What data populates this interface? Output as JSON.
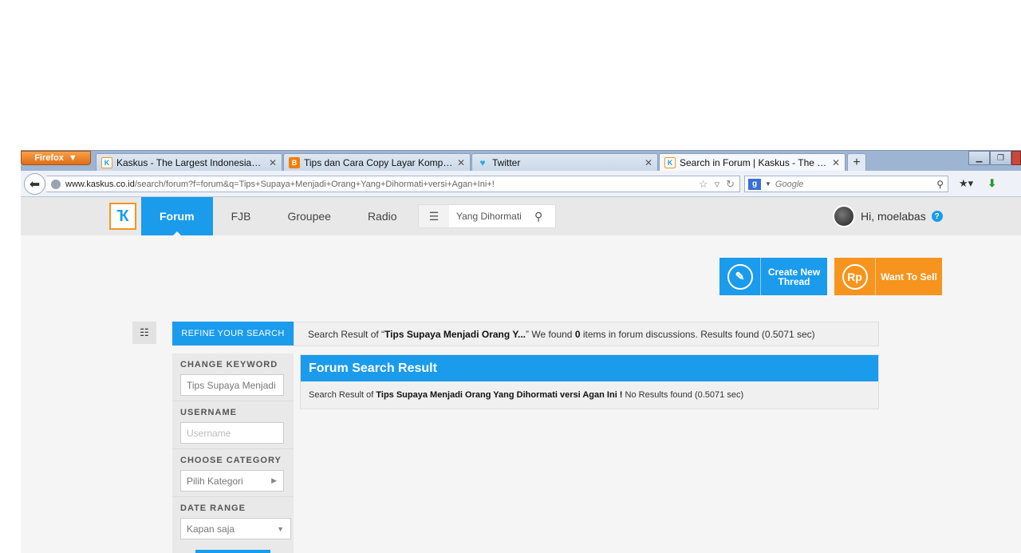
{
  "browser": {
    "firefox_label": "Firefox",
    "tabs": [
      {
        "label": "Kaskus - The Largest Indonesian Com...",
        "icon": "kaskus-favicon"
      },
      {
        "label": "Tips dan Cara Copy Layar Komputer ...",
        "icon": "blogger-favicon"
      },
      {
        "label": "Twitter",
        "icon": "twitter-favicon"
      },
      {
        "label": "Search in Forum | Kaskus - The Large...",
        "icon": "kaskus-favicon"
      }
    ],
    "url_domain": "www.kaskus.co.id",
    "url_path": "/search/forum?f=forum&q=Tips+Supaya+Menjadi+Orang+Yang+Dihormati+versi+Agan+Ini+!",
    "search_placeholder": "Google"
  },
  "header": {
    "nav": [
      "Forum",
      "FJB",
      "Groupee",
      "Radio"
    ],
    "search_value": "Yang Dihormati",
    "greeting": "Hi, moelabas"
  },
  "actions": {
    "create_thread": "Create New Thread",
    "want_to_sell": "Want To Sell"
  },
  "refine": {
    "tab_label": "REFINE YOUR SEARCH",
    "keyword_label": "CHANGE KEYWORD",
    "keyword_value": "Tips Supaya Menjadi",
    "username_label": "USERNAME",
    "username_placeholder": "Username",
    "category_label": "CHOOSE CATEGORY",
    "category_value": "Pilih Kategori",
    "date_label": "DATE RANGE",
    "date_value": "Kapan saja"
  },
  "summary": {
    "prefix": "Search Result of “",
    "query": "Tips Supaya Menjadi Orang Y...",
    "middle": "” We found ",
    "count": "0",
    "suffix": " items in forum discussions. Results found (0.5071 sec)"
  },
  "results": {
    "title": "Forum Search Result",
    "prefix": "Search Result of ",
    "query": "Tips Supaya Menjadi Orang Yang Dihormati versi Agan Ini !",
    "suffix": " No Results found (0.5071 sec)"
  },
  "colors": {
    "kaskus_blue": "#1a9bec",
    "kaskus_orange": "#f7941d"
  }
}
